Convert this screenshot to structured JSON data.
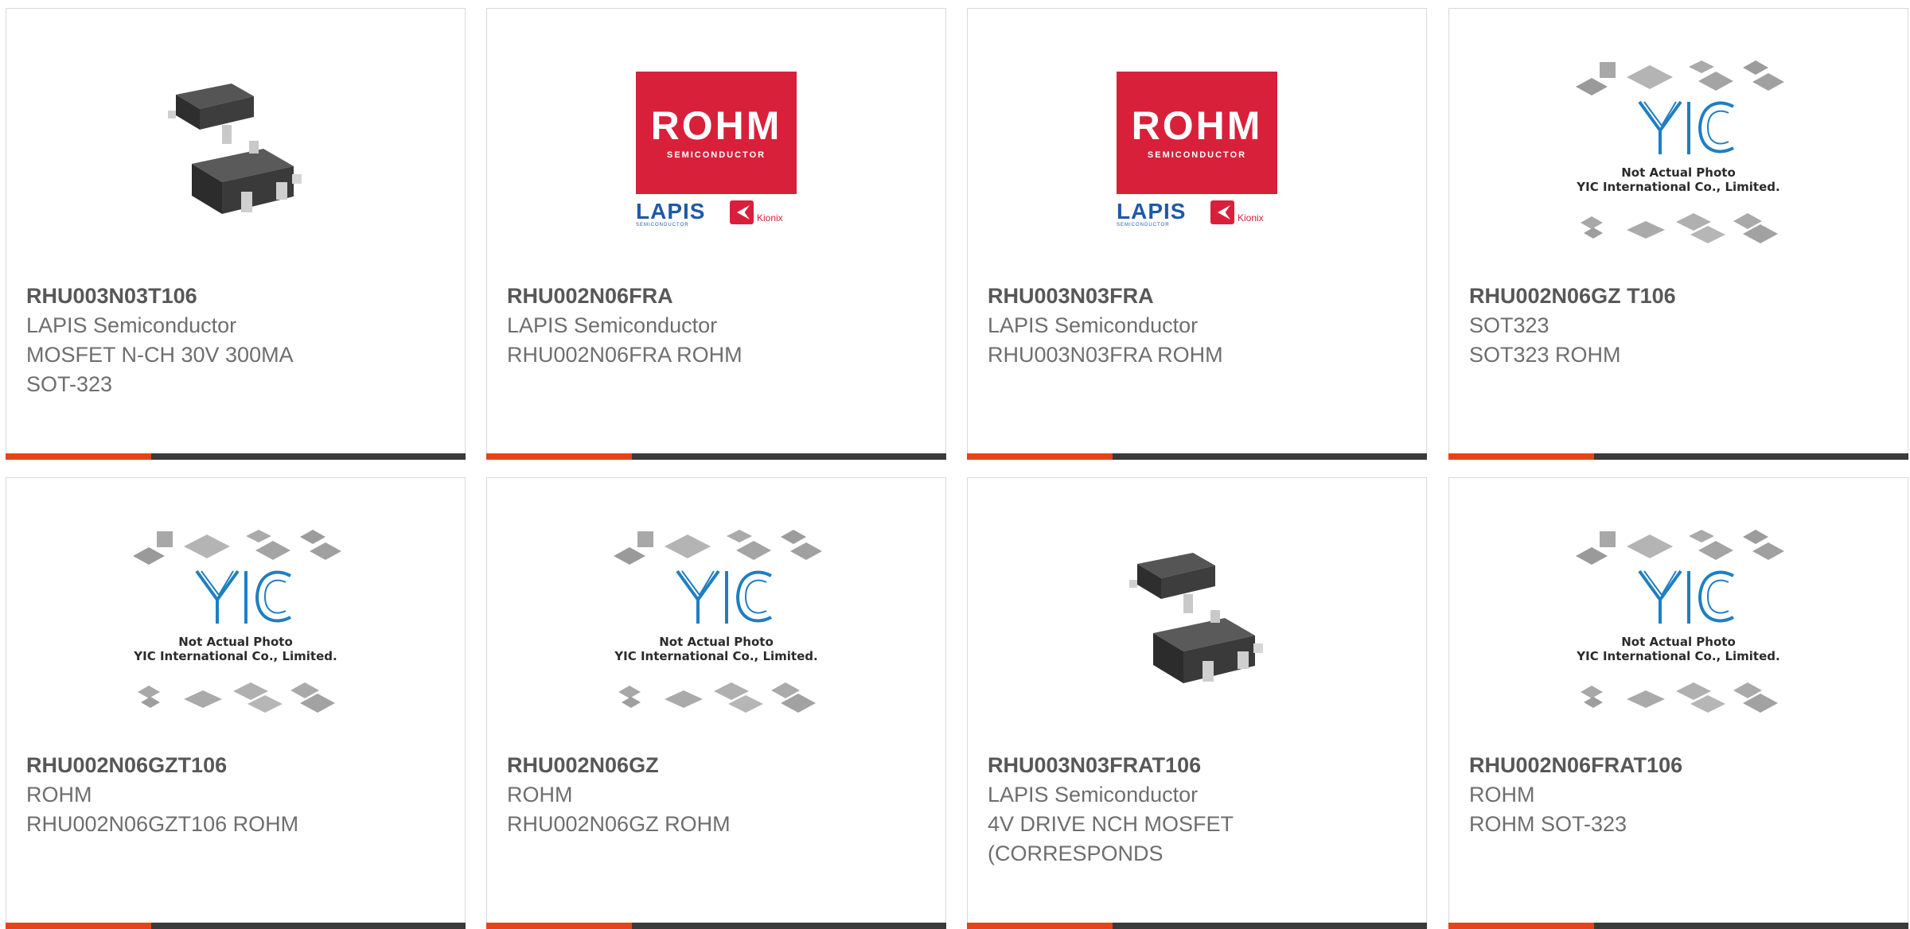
{
  "colors": {
    "accent": "#e8421c",
    "bar": "#3a3a3a",
    "rohm_red": "#d9203a",
    "yic_blue": "#1f7ec2"
  },
  "rohm_logo": {
    "brand": "ROHM",
    "sub": "SEMICONDUCTOR",
    "lapis": "LAPIS",
    "lapis_sub": "SEMICONDUCTOR",
    "kionix": "Kionix"
  },
  "yic_placeholder": {
    "mark": "YIC",
    "line1": "Not Actual Photo",
    "line2": "YIC International Co., Limited."
  },
  "products": [
    {
      "part": "RHU003N03T106",
      "lines": [
        "LAPIS Semiconductor",
        "MOSFET N-CH 30V 300MA",
        "SOT-323"
      ],
      "image": "sot323-photo-icon"
    },
    {
      "part": "RHU002N06FRA",
      "lines": [
        "LAPIS Semiconductor",
        "RHU002N06FRA ROHM",
        ""
      ],
      "image": "rohm-logo-icon"
    },
    {
      "part": "RHU003N03FRA",
      "lines": [
        "LAPIS Semiconductor",
        "RHU003N03FRA ROHM",
        ""
      ],
      "image": "rohm-logo-icon"
    },
    {
      "part": "RHU002N06GZ T106",
      "lines": [
        "SOT323",
        "SOT323 ROHM",
        ""
      ],
      "image": "yic-placeholder-icon"
    },
    {
      "part": "RHU002N06GZT106",
      "lines": [
        "ROHM",
        "RHU002N06GZT106 ROHM",
        ""
      ],
      "image": "yic-placeholder-icon"
    },
    {
      "part": "RHU002N06GZ",
      "lines": [
        "ROHM",
        "RHU002N06GZ ROHM",
        ""
      ],
      "image": "yic-placeholder-icon"
    },
    {
      "part": "RHU003N03FRAT106",
      "lines": [
        "LAPIS Semiconductor",
        "4V DRIVE NCH MOSFET",
        "(CORRESPONDS"
      ],
      "image": "sot323-photo-icon"
    },
    {
      "part": "RHU002N06FRAT106",
      "lines": [
        "ROHM",
        "ROHM SOT-323",
        ""
      ],
      "image": "yic-placeholder-icon"
    }
  ]
}
